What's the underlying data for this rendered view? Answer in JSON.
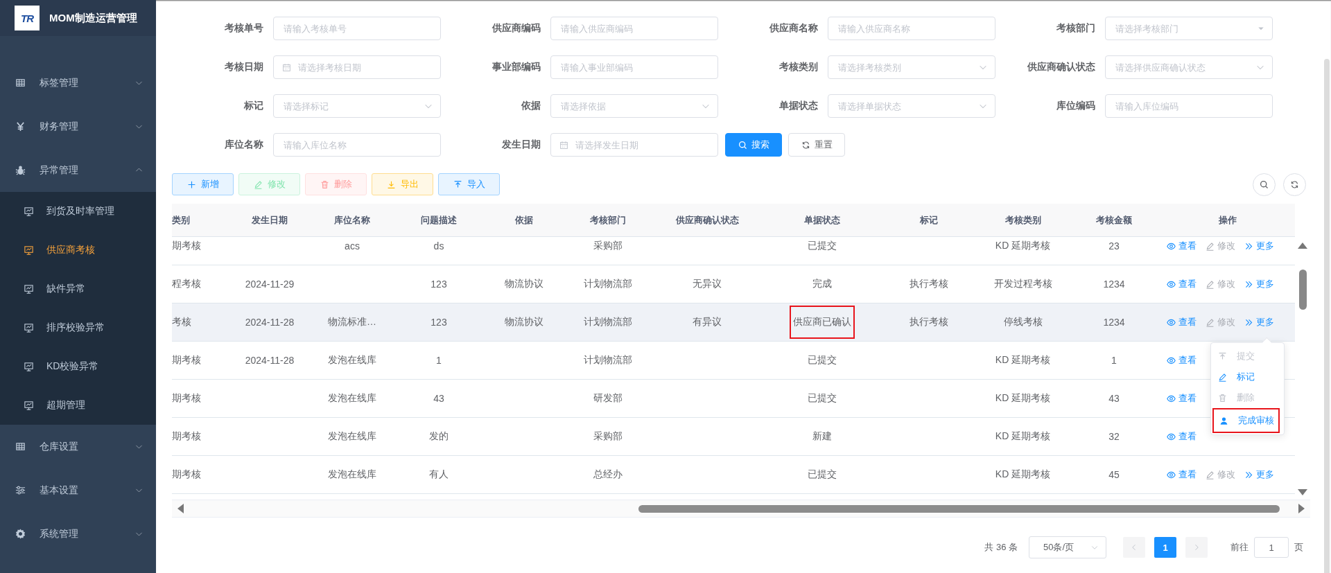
{
  "sidebar": {
    "logo": {
      "text": "TR"
    },
    "title": "MOM制造运营管理",
    "menu": [
      {
        "label": "标签管理",
        "expanded": false
      },
      {
        "label": "财务管理",
        "expanded": false
      },
      {
        "label": "异常管理",
        "expanded": true,
        "children": [
          {
            "label": "到货及时率管理",
            "selected": false
          },
          {
            "label": "供应商考核",
            "selected": true
          },
          {
            "label": "缺件异常",
            "selected": false
          },
          {
            "label": "排序校验异常",
            "selected": false
          },
          {
            "label": "KD校验异常",
            "selected": false
          },
          {
            "label": "超期管理",
            "selected": false
          }
        ]
      },
      {
        "label": "仓库设置",
        "expanded": false
      },
      {
        "label": "基本设置",
        "expanded": false
      },
      {
        "label": "系统管理",
        "expanded": false
      }
    ]
  },
  "filters": {
    "fields": [
      {
        "label": "考核单号",
        "kind": "text",
        "placeholder": "请输入考核单号"
      },
      {
        "label": "供应商编码",
        "kind": "text",
        "placeholder": "请输入供应商编码"
      },
      {
        "label": "供应商名称",
        "kind": "text",
        "placeholder": "请输入供应商名称"
      },
      {
        "label": "考核部门",
        "kind": "combo",
        "placeholder": "请选择考核部门"
      },
      {
        "label": "考核日期",
        "kind": "date",
        "placeholder": "请选择考核日期"
      },
      {
        "label": "事业部编码",
        "kind": "text",
        "placeholder": "请输入事业部编码"
      },
      {
        "label": "考核类别",
        "kind": "select",
        "placeholder": "请选择考核类别"
      },
      {
        "label": "供应商确认状态",
        "kind": "select",
        "placeholder": "请选择供应商确认状态"
      },
      {
        "label": "标记",
        "kind": "select",
        "placeholder": "请选择标记"
      },
      {
        "label": "依据",
        "kind": "select",
        "placeholder": "请选择依据"
      },
      {
        "label": "单据状态",
        "kind": "select",
        "placeholder": "请选择单据状态"
      },
      {
        "label": "库位编码",
        "kind": "text",
        "placeholder": "请输入库位编码"
      },
      {
        "label": "库位名称",
        "kind": "text",
        "placeholder": "请输入库位名称"
      },
      {
        "label": "发生日期",
        "kind": "date",
        "placeholder": "请选择发生日期"
      }
    ],
    "search_button": "搜索",
    "reset_button": "重置"
  },
  "toolbar": [
    {
      "label": "新增",
      "kind": "primary",
      "disabled": false
    },
    {
      "label": "修改",
      "kind": "success",
      "disabled": true
    },
    {
      "label": "删除",
      "kind": "danger",
      "disabled": true
    },
    {
      "label": "导出",
      "kind": "warning",
      "disabled": false
    },
    {
      "label": "导入",
      "kind": "primary",
      "disabled": false
    }
  ],
  "table": {
    "columns": [
      {
        "title": "类别",
        "kind": "text"
      },
      {
        "title": "发生日期",
        "kind": "text"
      },
      {
        "title": "库位名称",
        "kind": "text"
      },
      {
        "title": "问题描述",
        "kind": "text"
      },
      {
        "title": "依据",
        "kind": "text"
      },
      {
        "title": "考核部门",
        "kind": "text"
      },
      {
        "title": "供应商确认状态",
        "kind": "text"
      },
      {
        "title": "单据状态",
        "kind": "status"
      },
      {
        "title": "标记",
        "kind": "text"
      },
      {
        "title": "考核类别",
        "kind": "text"
      },
      {
        "title": "考核金额",
        "kind": "text"
      },
      {
        "title": "操作",
        "kind": "actions"
      }
    ],
    "rows": [
      {
        "cells": [
          "期考核",
          null,
          "acs",
          "ds",
          null,
          "采购部",
          null,
          "已提交",
          null,
          "KD 延期考核",
          "23"
        ],
        "hovered": false,
        "status_highlighted": false,
        "actions": [
          {
            "label": "查看",
            "disabled": false
          },
          {
            "label": "修改",
            "disabled": true
          },
          {
            "label": "更多",
            "disabled": false
          }
        ]
      },
      {
        "cells": [
          "程考核",
          "2024-11-29",
          null,
          "123",
          "物流协议",
          "计划物流部",
          "无异议",
          "完成",
          "执行考核",
          "开发过程考核",
          "1234"
        ],
        "hovered": false,
        "status_highlighted": false,
        "actions": [
          {
            "label": "查看",
            "disabled": false
          },
          {
            "label": "修改",
            "disabled": true
          },
          {
            "label": "更多",
            "disabled": false
          }
        ]
      },
      {
        "cells": [
          "考核",
          "2024-11-28",
          "物流标准…",
          "123",
          "物流协议",
          "计划物流部",
          "有异议",
          "供应商已确认",
          "执行考核",
          "停线考核",
          "1234"
        ],
        "hovered": true,
        "status_highlighted": true,
        "actions": [
          {
            "label": "查看",
            "disabled": false
          },
          {
            "label": "修改",
            "disabled": true
          },
          {
            "label": "更多",
            "disabled": false
          }
        ]
      },
      {
        "cells": [
          "期考核",
          "2024-11-28",
          "发泡在线库",
          "1",
          null,
          "计划物流部",
          null,
          "已提交",
          null,
          "KD 延期考核",
          "1"
        ],
        "hovered": false,
        "status_highlighted": false,
        "actions": [
          {
            "label": "查看",
            "disabled": false
          }
        ]
      },
      {
        "cells": [
          "期考核",
          null,
          "发泡在线库",
          "43",
          null,
          "研发部",
          null,
          "已提交",
          null,
          "KD 延期考核",
          "43"
        ],
        "hovered": false,
        "status_highlighted": false,
        "actions": [
          {
            "label": "查看",
            "disabled": false
          }
        ]
      },
      {
        "cells": [
          "期考核",
          null,
          "发泡在线库",
          "发的",
          null,
          "采购部",
          null,
          "新建",
          null,
          "KD 延期考核",
          "32"
        ],
        "hovered": false,
        "status_highlighted": false,
        "actions": [
          {
            "label": "查看",
            "disabled": false
          }
        ]
      },
      {
        "cells": [
          "期考核",
          null,
          "发泡在线库",
          "有人",
          null,
          "总经办",
          null,
          "已提交",
          null,
          "KD 延期考核",
          "45"
        ],
        "hovered": false,
        "status_highlighted": false,
        "actions": [
          {
            "label": "查看",
            "disabled": false
          },
          {
            "label": "修改",
            "disabled": true
          },
          {
            "label": "更多",
            "disabled": false
          }
        ]
      }
    ],
    "more_menu": [
      {
        "label": "提交",
        "disabled": true,
        "highlighted": false
      },
      {
        "label": "标记",
        "disabled": false,
        "highlighted": false
      },
      {
        "label": "删除",
        "disabled": true,
        "highlighted": false
      },
      {
        "label": "完成审核",
        "disabled": false,
        "highlighted": true
      }
    ]
  },
  "pagination": {
    "total": "共 36 条",
    "page_size": "50条/页",
    "prev_disabled": true,
    "next_disabled": true,
    "pages": [
      {
        "label": "1",
        "selected": true
      }
    ],
    "goto_label": "前往",
    "goto_value": "1",
    "goto_unit": "页"
  }
}
